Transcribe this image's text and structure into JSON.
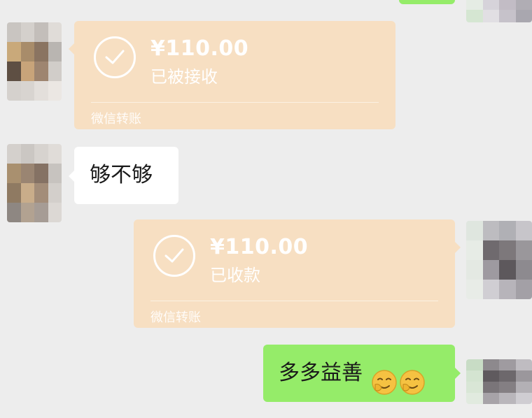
{
  "chat": {
    "messages": [
      {
        "side": "left",
        "type": "transfer",
        "amount": "¥110.00",
        "status": "已被接收",
        "footer": "微信转账"
      },
      {
        "side": "left",
        "type": "text",
        "text": "够不够"
      },
      {
        "side": "right",
        "type": "transfer",
        "amount": "¥110.00",
        "status": "已收款",
        "footer": "微信转账"
      },
      {
        "side": "right",
        "type": "text",
        "text": "多多益善",
        "emoji_icons": [
          "sheepish-smile-emoji",
          "sheepish-smile-emoji"
        ]
      }
    ]
  },
  "colors": {
    "background": "#ededed",
    "incoming_bubble": "#ffffff",
    "outgoing_bubble": "#95ec69",
    "transfer_bubble": "#f7dfc2",
    "emoji_yellow": "#f5c242"
  }
}
